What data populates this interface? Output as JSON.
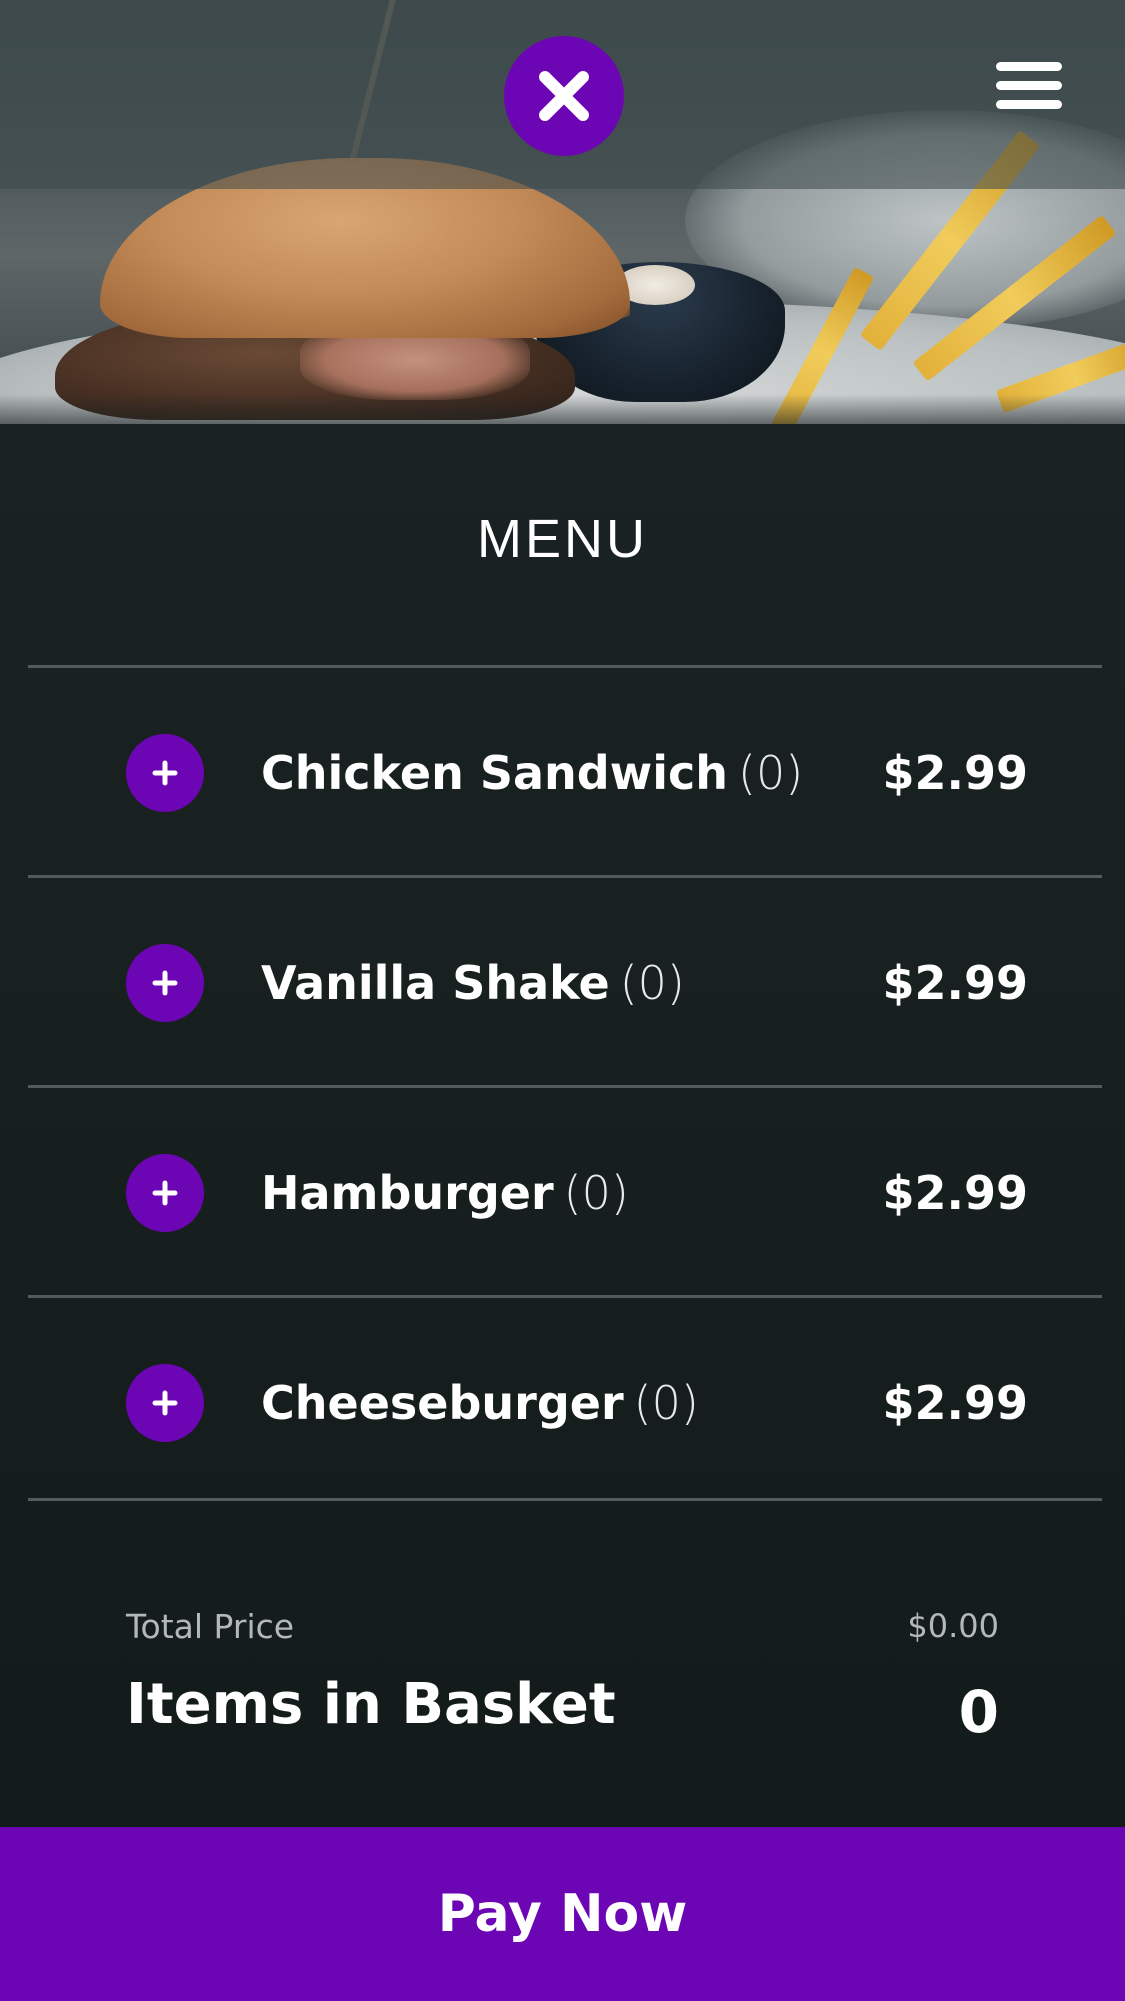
{
  "header": {
    "close_icon": "close-icon",
    "menu_icon": "hamburger-menu-icon",
    "accent_color": "#6c05b3"
  },
  "menu": {
    "title": "MENU",
    "items": [
      {
        "name": "Chicken Sandwich",
        "count": "(0)",
        "price": "$2.99",
        "icon": "plus-icon"
      },
      {
        "name": "Vanilla Shake",
        "count": "(0)",
        "price": "$2.99",
        "icon": "plus-icon"
      },
      {
        "name": "Hamburger",
        "count": "(0)",
        "price": "$2.99",
        "icon": "plus-icon"
      },
      {
        "name": "Cheeseburger",
        "count": "(0)",
        "price": "$2.99",
        "icon": "plus-icon"
      }
    ]
  },
  "summary": {
    "total_label": "Total Price",
    "total_value": "$0.00",
    "basket_label": "Items in Basket",
    "basket_value": "0"
  },
  "footer": {
    "pay_label": "Pay Now"
  }
}
